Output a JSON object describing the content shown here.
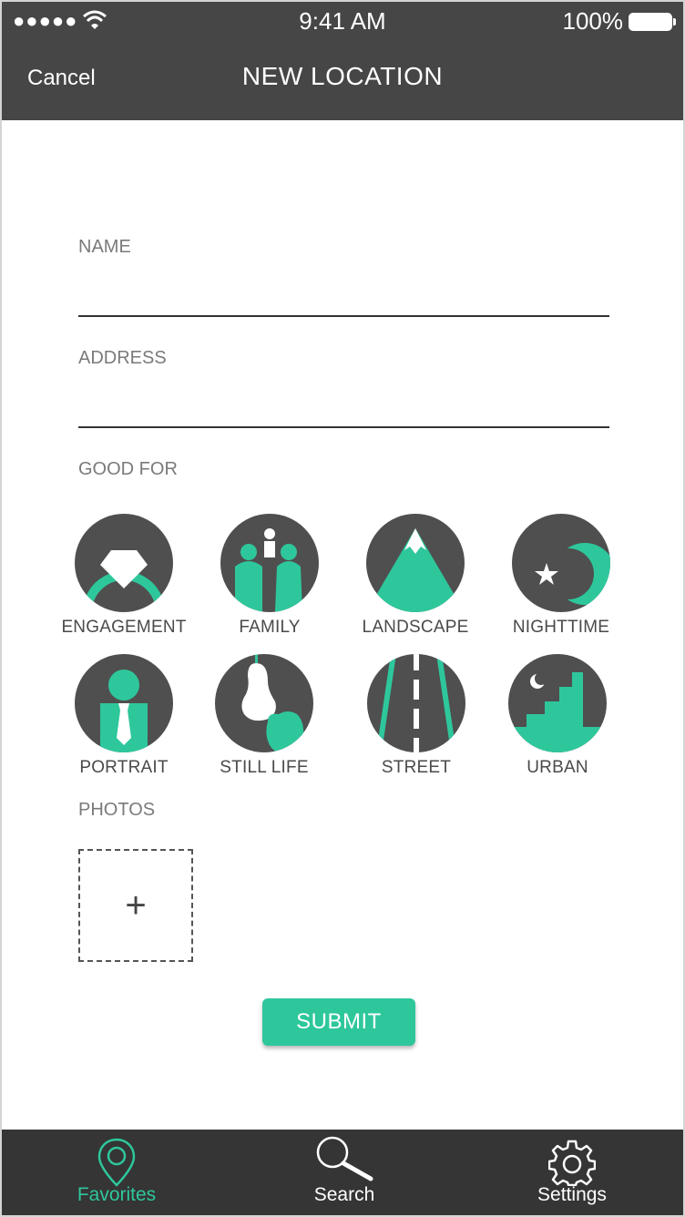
{
  "status_bar": {
    "time": "9:41 AM",
    "battery": "100%",
    "signal": "●●●●●"
  },
  "nav": {
    "cancel_label": "Cancel",
    "title": "NEW LOCATION"
  },
  "form": {
    "name_label": "NAME",
    "name_value": "",
    "address_label": "ADDRESS",
    "address_value": "",
    "good_for_label": "GOOD FOR",
    "photos_label": "PHOTOS",
    "add_photo_symbol": "+",
    "submit_label": "SUBMIT"
  },
  "categories": [
    {
      "label": "ENGAGEMENT",
      "icon": "engagement-ring-icon"
    },
    {
      "label": "FAMILY",
      "icon": "family-icon"
    },
    {
      "label": "LANDSCAPE",
      "icon": "mountain-icon"
    },
    {
      "label": "NIGHTTIME",
      "icon": "moon-star-icon"
    },
    {
      "label": "PORTRAIT",
      "icon": "person-tie-icon"
    },
    {
      "label": "STILL LIFE",
      "icon": "pear-apple-icon"
    },
    {
      "label": "STREET",
      "icon": "road-icon"
    },
    {
      "label": "URBAN",
      "icon": "city-skyline-icon"
    }
  ],
  "tabs": [
    {
      "label": "Favorites",
      "icon": "map-pin-icon",
      "active": true
    },
    {
      "label": "Search",
      "icon": "search-icon",
      "active": false
    },
    {
      "label": "Settings",
      "icon": "gear-icon",
      "active": false
    }
  ],
  "colors": {
    "accent": "#2ec79c",
    "dark": "#464646",
    "tab_bar": "#353535",
    "icon_bg": "#4f4f4f"
  }
}
